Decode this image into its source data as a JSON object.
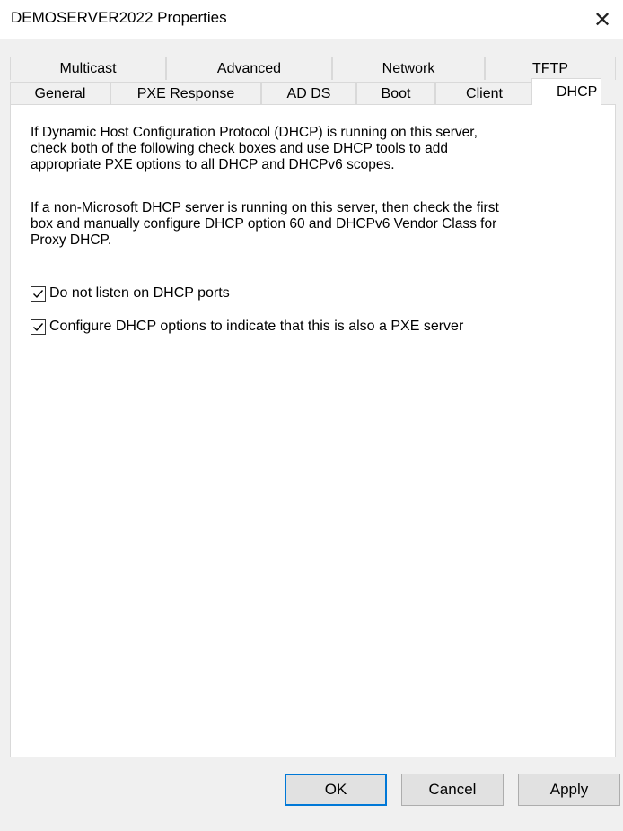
{
  "window": {
    "title": "DEMOSERVER2022 Properties",
    "close_glyph": "✕"
  },
  "tabs_row_back": [
    "Multicast",
    "Advanced",
    "Network",
    "TFTP"
  ],
  "tabs_row_front": [
    "General",
    "PXE Response",
    "AD DS",
    "Boot",
    "Client",
    "DHCP"
  ],
  "selected_tab": "DHCP",
  "panel": {
    "paragraph1_lines": [
      "If Dynamic Host Configuration Protocol (DHCP) is running on this server,",
      "check both of the following check boxes and use DHCP tools to add",
      "appropriate PXE options to all DHCP and DHCPv6 scopes."
    ],
    "paragraph2_lines": [
      "If a non-Microsoft DHCP server is running on this server, then check the first",
      "box and manually configure DHCP option 60 and DHCPv6 Vendor Class for",
      "Proxy DHCP."
    ],
    "checkbox1": {
      "label": "Do not listen on DHCP ports",
      "checked": true
    },
    "checkbox2": {
      "label": "Configure DHCP options to indicate that this is also a PXE server",
      "checked": true
    }
  },
  "buttons": {
    "ok": "OK",
    "cancel": "Cancel",
    "apply": "Apply"
  },
  "colors": {
    "accent": "#0078d7",
    "dialog_bg": "#f0f0f0",
    "panel_bg": "#ffffff"
  }
}
